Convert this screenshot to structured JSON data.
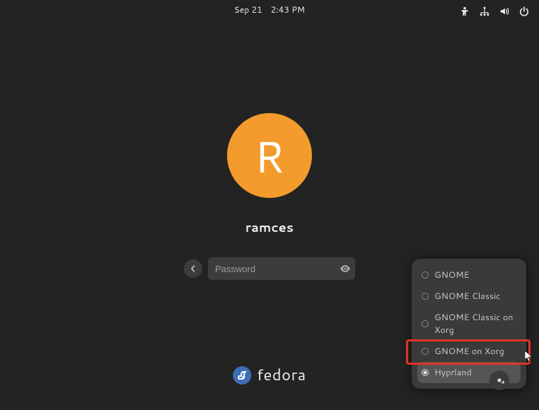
{
  "topbar": {
    "date": "Sep 21",
    "time": "2:43 PM"
  },
  "user": {
    "initial": "R",
    "name": "ramces"
  },
  "password": {
    "placeholder": "Password",
    "value": ""
  },
  "sessions": {
    "items": [
      {
        "label": "GNOME",
        "selected": false
      },
      {
        "label": "GNOME Classic",
        "selected": false
      },
      {
        "label": "GNOME Classic on Xorg",
        "selected": false
      },
      {
        "label": "GNOME on Xorg",
        "selected": false
      },
      {
        "label": "Hyprland",
        "selected": true
      }
    ]
  },
  "brand": {
    "name": "fedora"
  },
  "colors": {
    "avatar": "#f39c2d",
    "highlight": "#e2332a",
    "brand": "#3c6eb4"
  }
}
